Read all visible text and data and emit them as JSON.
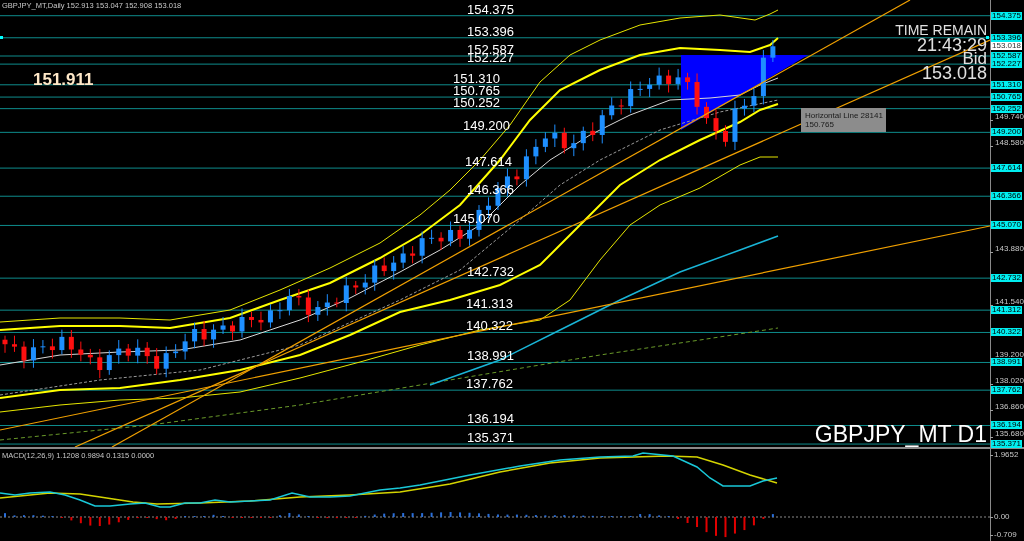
{
  "chart": {
    "title": "GBPJPY_MT,Daily 152.913 153.047 152.908 153.018",
    "price_marker": "151.911",
    "symbol_label": "GBPJPY_MT D1"
  },
  "levels": [
    {
      "chart_label": "154.375",
      "axis_label": "154.375"
    },
    {
      "chart_label": "153.396",
      "axis_label": "153.396"
    },
    {
      "chart_label": "152.587",
      "axis_label": "152.587"
    },
    {
      "chart_label": "152.227",
      "axis_label": "152.227"
    },
    {
      "chart_label": "151.310",
      "axis_label": "151.310"
    },
    {
      "chart_label": "150.765",
      "axis_label": "150.765"
    },
    {
      "chart_label": "150.252",
      "axis_label": "150.252"
    },
    {
      "chart_label": "149.200",
      "axis_label": "149.200"
    },
    {
      "chart_label": "147.614",
      "axis_label": "147.614"
    },
    {
      "chart_label": "146.366",
      "axis_label": "146.366"
    },
    {
      "chart_label": "145.070",
      "axis_label": "145.070"
    },
    {
      "chart_label": "142.732",
      "axis_label": "142.732"
    },
    {
      "chart_label": "141.313",
      "axis_label": "141.312"
    },
    {
      "chart_label": "140.322",
      "axis_label": "140.322"
    },
    {
      "chart_label": "138.991",
      "axis_label": "138.991"
    },
    {
      "chart_label": "137.762",
      "axis_label": "137.762"
    },
    {
      "chart_label": "136.194",
      "axis_label": "136.194"
    },
    {
      "chart_label": "135.371",
      "axis_label": "135.371"
    }
  ],
  "current_price": {
    "axis_label": "153.018"
  },
  "info_panel": {
    "time_remain_label": "TIME REMAIN",
    "time_remain": "21:43:29",
    "bid_label": "Bid",
    "bid": "153.018"
  },
  "tooltip": {
    "title": "Horizontal Line 28141",
    "value": "150.765"
  },
  "price_axis_ticks": [
    "149.740",
    "148.580",
    "143.880",
    "141.540",
    "139.200",
    "138.020",
    "136.860",
    "135.680"
  ],
  "macd": {
    "title": "MACD(12,26,9) 1.1208 0.9894 0.1315 0.0000",
    "axis_ticks": [
      "1.9652",
      "0.00",
      "-0.709"
    ]
  }
}
